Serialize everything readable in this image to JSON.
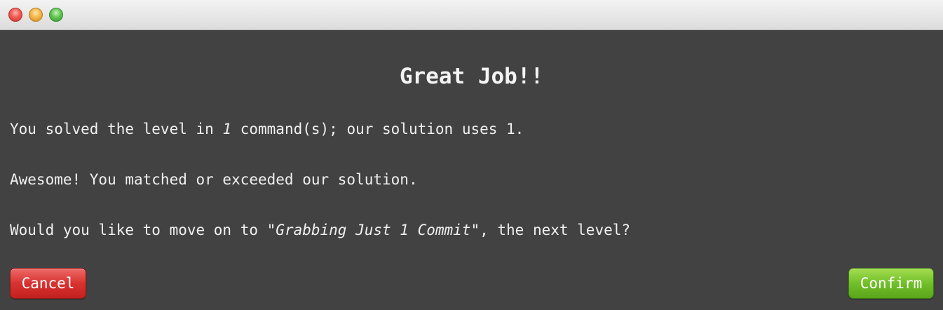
{
  "window": {
    "controls": [
      "close",
      "minimize",
      "zoom"
    ]
  },
  "dialog": {
    "title": "Great Job!!",
    "line1": {
      "before": "You solved the level in ",
      "count": "1",
      "after": " command(s); our solution uses 1."
    },
    "line2": "Awesome! You matched or exceeded our solution.",
    "line3": {
      "before": "Would you like to move on to ",
      "level_name": "\"Grabbing Just 1 Commit\"",
      "after": ", the next level?"
    }
  },
  "buttons": {
    "cancel": "Cancel",
    "confirm": "Confirm"
  },
  "colors": {
    "background": "#424242",
    "cancel": "#d83330",
    "confirm": "#72bf2a"
  }
}
